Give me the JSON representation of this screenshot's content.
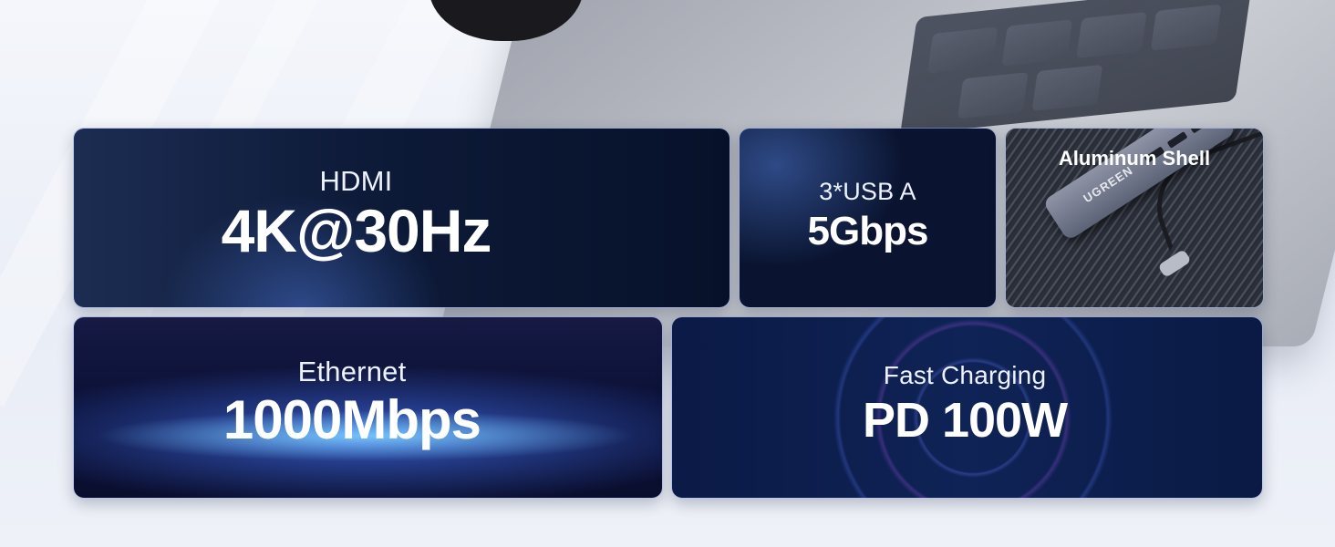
{
  "cards": {
    "hdmi": {
      "label": "HDMI",
      "value": "4K@30Hz"
    },
    "usb": {
      "label": "3*USB A",
      "value": "5Gbps"
    },
    "aluminum": {
      "label": "Aluminum Shell",
      "brand": "UGREEN"
    },
    "ethernet": {
      "label": "Ethernet",
      "value": "1000Mbps"
    },
    "charging": {
      "label": "Fast Charging",
      "value": "PD 100W"
    }
  },
  "colors": {
    "card_dark": "#0d1a38",
    "card_border": "#8ca0dc",
    "text": "#ffffff",
    "background": "#eef1f8"
  }
}
